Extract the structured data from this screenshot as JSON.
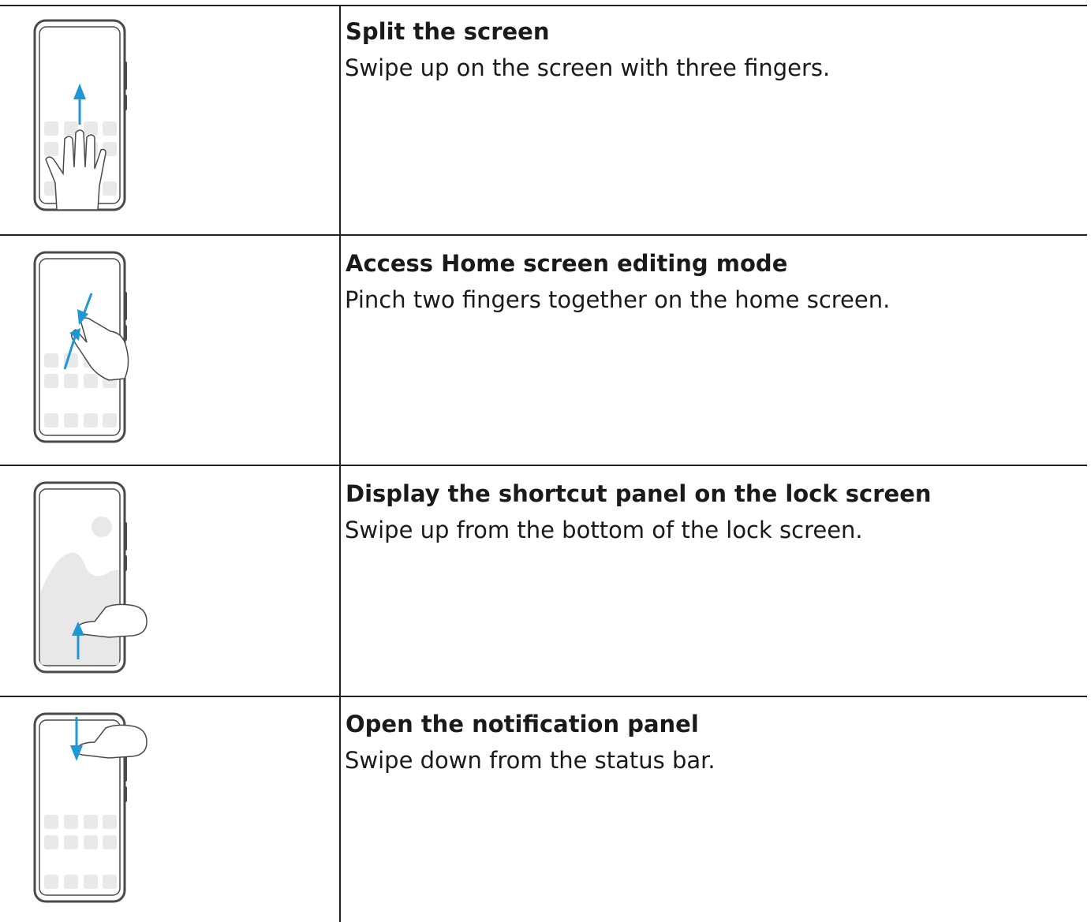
{
  "colors": {
    "phone_outline": "#4a4a4a",
    "phone_fill": "#ffffff",
    "app_tile": "#e9e9e9",
    "wallpaper": "#e8e8e8",
    "arrow": "#1f96d6",
    "rule": "#222222"
  },
  "gestures": [
    {
      "title": "Split the screen",
      "description": "Swipe up on the screen with three fingers.",
      "icon": "three-finger-swipe-up-icon"
    },
    {
      "title": "Access Home screen editing mode",
      "description": "Pinch two fingers together on the home screen.",
      "icon": "two-finger-pinch-icon"
    },
    {
      "title": "Display the shortcut panel on the lock screen",
      "description": "Swipe up from the bottom of the lock screen.",
      "icon": "swipe-up-from-bottom-icon"
    },
    {
      "title": "Open the notification panel",
      "description": "Swipe down from the status bar.",
      "icon": "swipe-down-from-status-bar-icon"
    }
  ]
}
